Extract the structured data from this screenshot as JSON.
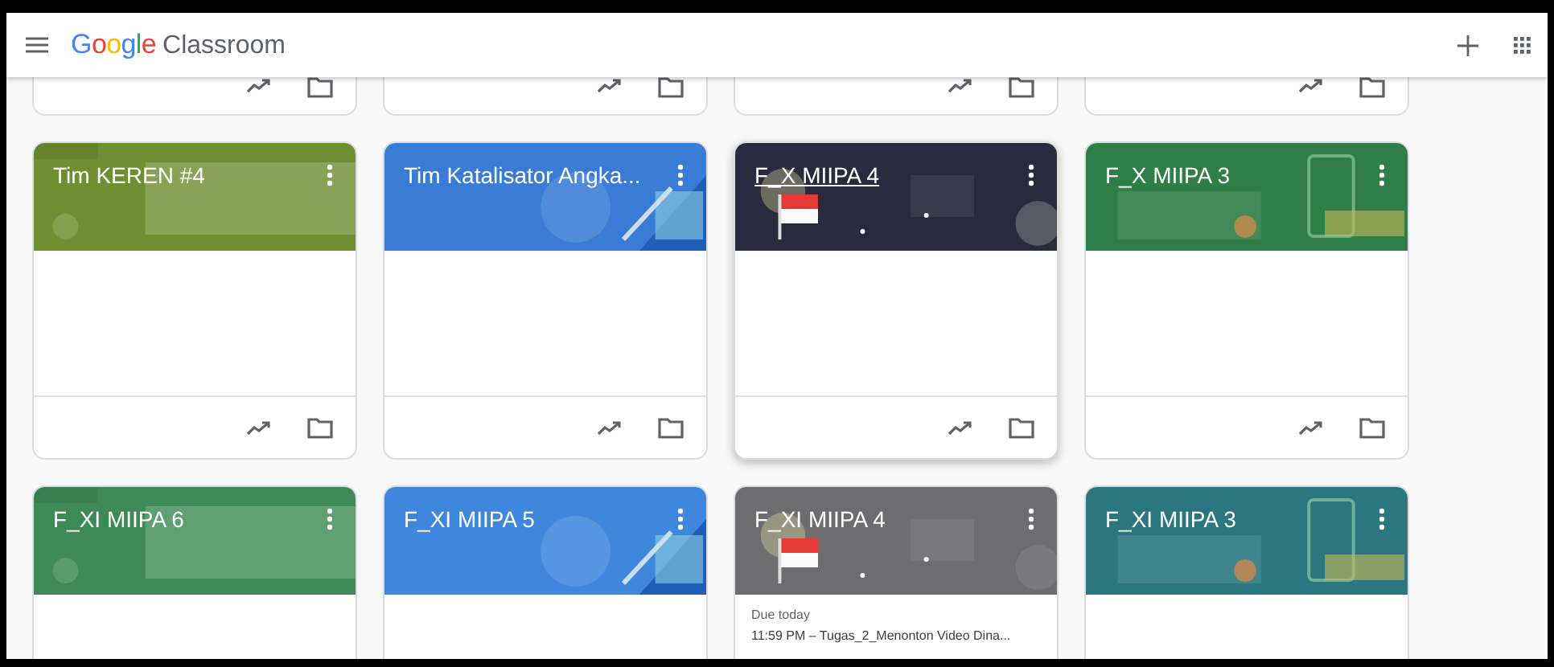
{
  "app_bar": {
    "logo": "Google",
    "title": "Classroom"
  },
  "partial_cards": [
    {
      "kind": "footer"
    },
    {
      "kind": "footer"
    },
    {
      "kind": "footer"
    },
    {
      "kind": "footer"
    }
  ],
  "cards": [
    {
      "title": "Tim KEREN #4",
      "color": "#6e8f32",
      "hovered": false
    },
    {
      "title": "Tim Katalisator Angka...",
      "color": "#3a7bd5",
      "hovered": false
    },
    {
      "title": "F_X MIIPA 4",
      "color": "#2a2a3e",
      "hovered": true
    },
    {
      "title": "F_X MIIPA 3",
      "color": "#2f7d47",
      "hovered": false
    }
  ],
  "bottom_cards": [
    {
      "title": "F_XI MIIPA 6",
      "color": "#3d8a56"
    },
    {
      "title": "F_XI MIIPA 5",
      "color": "#3f87dc"
    },
    {
      "title": "F_XI MIIPA 4",
      "color": "#6d6d70",
      "due": "Due today",
      "assignment": "11:59 PM – Tugas_2_Menonton Video Dina..."
    },
    {
      "title": "F_XI MIIPA 3",
      "color": "#2b7780"
    }
  ]
}
